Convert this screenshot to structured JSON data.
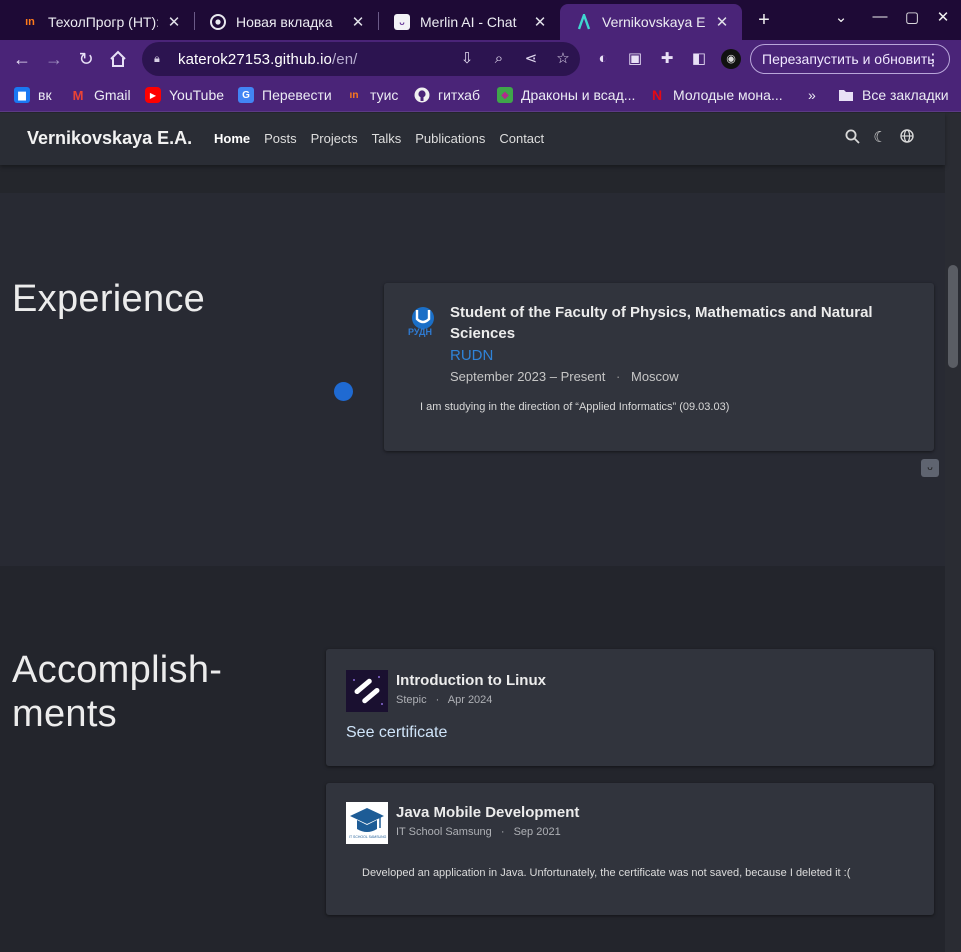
{
  "browser": {
    "tabs": [
      {
        "title": "ТехолПрогр (НТ): Э",
        "active": false,
        "favicon": "hexlet-favicon"
      },
      {
        "title": "Новая вкладка",
        "active": false,
        "favicon": "chrome-favicon"
      },
      {
        "title": "Merlin AI - Chat",
        "active": false,
        "favicon": "merlin-favicon"
      },
      {
        "title": "Vernikovskaya E.A.",
        "active": true,
        "favicon": "site-a-favicon"
      }
    ],
    "address": {
      "host": "katerok27153.github.io",
      "path": "/en/"
    },
    "relaunch_label": "Перезапустить и обновить",
    "bookmarks": [
      {
        "label": "вк",
        "icon": "vk-icon"
      },
      {
        "label": "Gmail",
        "icon": "gmail-icon"
      },
      {
        "label": "YouTube",
        "icon": "youtube-icon"
      },
      {
        "label": "Перевести",
        "icon": "translate-icon"
      },
      {
        "label": "туис",
        "icon": "hexlet-icon"
      },
      {
        "label": "гитхаб",
        "icon": "github-icon"
      },
      {
        "label": "Драконы и всад...",
        "icon": "dragon-icon"
      },
      {
        "label": "Молодые мона...",
        "icon": "netflix-icon"
      }
    ],
    "all_bookmarks_label": "Все закладки",
    "colors": {
      "tabbar": "#1e0a36",
      "toolbar": "#4a2478",
      "accent": "#1f6ad2"
    }
  },
  "site": {
    "brand": "Vernikovskaya E.A.",
    "menu": [
      "Home",
      "Posts",
      "Projects",
      "Talks",
      "Publications",
      "Contact"
    ],
    "current": "Home"
  },
  "experience": {
    "heading": "Experience",
    "items": [
      {
        "title": "Student of the Faculty of Physics, Mathematics and Natural Sciences",
        "org": "RUDN",
        "period": "September 2023 – Present",
        "location": "Moscow",
        "description": "I am studying in the direction of “Applied Informatics” (09.03.03)",
        "logo_text": "РУДН"
      }
    ]
  },
  "accomplishments": {
    "heading_line1": "Accomplish-",
    "heading_line2": "ments",
    "items": [
      {
        "title": "Introduction to Linux",
        "issuer": "Stepic",
        "date": "Apr 2024",
        "link": "See certificate"
      },
      {
        "title": "Java Mobile Development",
        "issuer": "IT School Samsung",
        "date": "Sep 2021",
        "description": "Developed an application in Java. Unfortunately, the certificate was not saved, because I deleted it :(",
        "logo_text": "IT SCHOOL SAMSUNG"
      }
    ]
  }
}
